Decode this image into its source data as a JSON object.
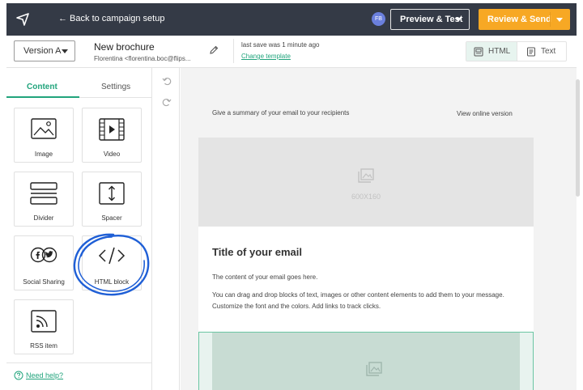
{
  "topbar": {
    "back_label": "← Back to campaign setup",
    "avatar_initials": "FB",
    "preview_label": "Preview & Test",
    "send_label": "Review & Send",
    "bg_color": "#343a46",
    "accent_color": "#f7a824"
  },
  "subheader": {
    "version_label": "Version A",
    "doc_title": "New brochure",
    "sender": "Florentina <florentina.boc@flips...",
    "save_status": "last save was 1 minute ago",
    "change_template_label": "Change template",
    "view_html_label": "HTML",
    "view_text_label": "Text"
  },
  "left_panel": {
    "tabs": [
      {
        "label": "Content",
        "active": true
      },
      {
        "label": "Settings",
        "active": false
      }
    ],
    "blocks": [
      {
        "label": "Image",
        "icon": "image-icon"
      },
      {
        "label": "Video",
        "icon": "video-icon"
      },
      {
        "label": "Divider",
        "icon": "divider-icon"
      },
      {
        "label": "Spacer",
        "icon": "spacer-icon"
      },
      {
        "label": "Social Sharing",
        "icon": "social-sharing-icon"
      },
      {
        "label": "HTML block",
        "icon": "code-icon"
      },
      {
        "label": "RSS item",
        "icon": "rss-icon"
      }
    ],
    "help_label": "Need help?",
    "brand_color": "#21a47c"
  },
  "canvas": {
    "summary_text": "Give a summary of your email to your recipients",
    "view_online_label": "View online version",
    "hero_dimensions": "600X160",
    "email_title": "Title of your email",
    "paragraph_1": "The content of your email goes here.",
    "paragraph_2": "You can drag and drop blocks of text, images or other content elements to add them to your message. Customize the font and the colors. Add links to track clicks."
  }
}
